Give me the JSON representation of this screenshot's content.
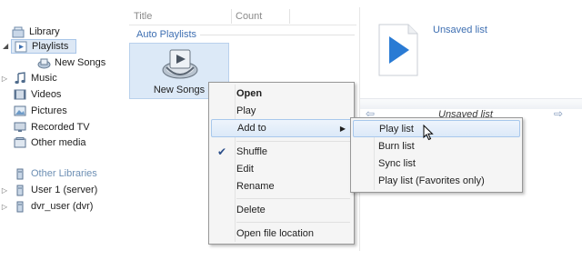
{
  "sidebar": {
    "library": "Library",
    "playlists": "Playlists",
    "new_songs": "New Songs",
    "music": "Music",
    "videos": "Videos",
    "pictures": "Pictures",
    "recorded_tv": "Recorded TV",
    "other_media": "Other media",
    "other_libraries": "Other Libraries",
    "user1": "User 1 (server)",
    "dvr_user": "dvr_user (dvr)"
  },
  "columns": {
    "title": "Title",
    "count": "Count"
  },
  "content": {
    "section_title": "Auto Playlists",
    "tile_label": "New Songs"
  },
  "right_pane": {
    "title": "Unsaved list",
    "list_name": "Unsaved list"
  },
  "context_menu": {
    "open": "Open",
    "play": "Play",
    "add_to": "Add to",
    "shuffle": "Shuffle",
    "edit": "Edit",
    "rename": "Rename",
    "delete": "Delete",
    "open_file_location": "Open file location"
  },
  "submenu": {
    "play_list": "Play list",
    "burn_list": "Burn list",
    "sync_list": "Sync list",
    "play_list_favorites": "Play list (Favorites only)"
  },
  "colors": {
    "accent": "#3e6fb2",
    "selection": "#dde8f5",
    "play_icon": "#2a7bd4"
  },
  "icons": {
    "sidebar": [
      "library-icon",
      "playlist-icon",
      "auto-playlist-icon",
      "music-icon",
      "videos-icon",
      "pictures-icon",
      "recorded-tv-icon",
      "other-media-icon",
      "other-libraries-icon",
      "server-icon",
      "server-icon"
    ],
    "tile": "auto-playlist-icon",
    "right_pane": "play-document-icon",
    "cursor": "pointer-icon"
  }
}
